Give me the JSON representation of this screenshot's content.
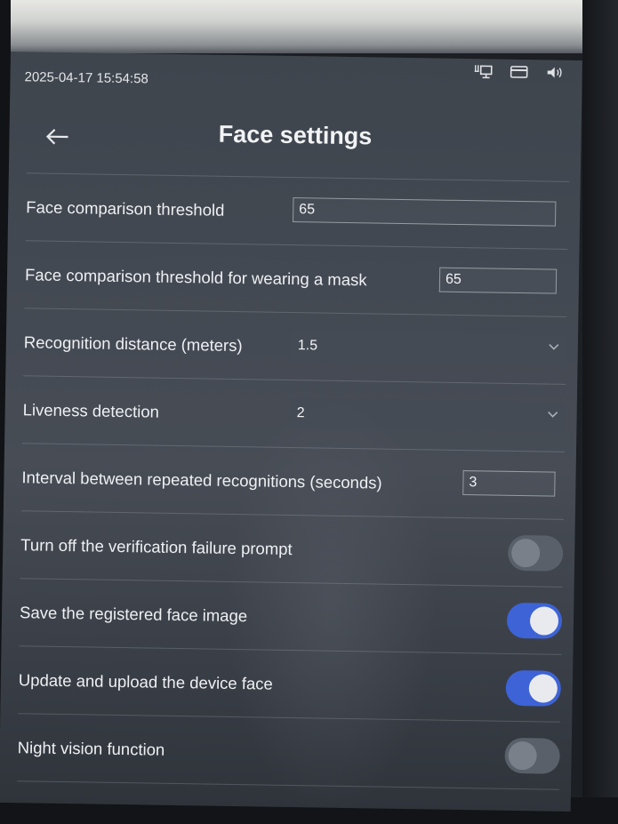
{
  "status_bar": {
    "datetime": "2025-04-17 15:54:58",
    "icons": [
      "network-icon",
      "card-icon",
      "volume-icon"
    ]
  },
  "header": {
    "title": "Face settings",
    "back_icon": "arrow-left-icon"
  },
  "settings": {
    "face_threshold": {
      "label": "Face comparison threshold",
      "value": "65"
    },
    "mask_threshold": {
      "label": "Face comparison threshold for wearing a mask",
      "value": "65"
    },
    "recognition_distance": {
      "label": "Recognition distance (meters)",
      "value": "1.5"
    },
    "liveness": {
      "label": "Liveness detection",
      "value": "2"
    },
    "interval": {
      "label": "Interval between repeated recognitions (seconds)",
      "value": "3"
    },
    "verification_prompt_off": {
      "label": "Turn off the verification failure prompt",
      "enabled": false
    },
    "save_face_image": {
      "label": "Save the registered face image",
      "enabled": true
    },
    "upload_device_face": {
      "label": "Update and upload the device face",
      "enabled": true
    },
    "night_vision": {
      "label": "Night vision function",
      "enabled": false
    }
  },
  "colors": {
    "toggle_on": "#3d63d6",
    "toggle_off": "#5a6069",
    "panel": "#434952"
  }
}
